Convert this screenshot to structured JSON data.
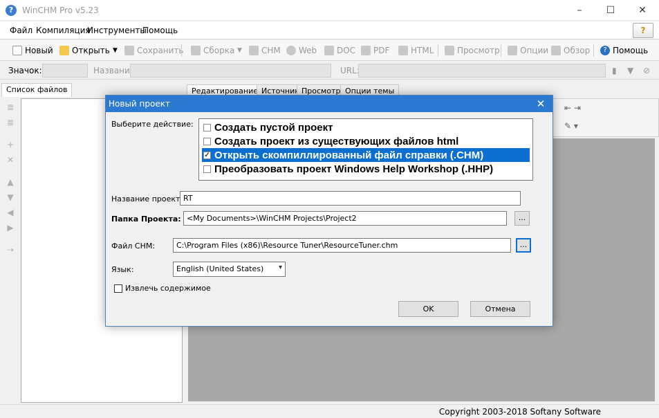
{
  "app": {
    "title": "WinCHM Pro v5.23",
    "icon_glyph": "?",
    "window_controls": {
      "minimize": "–",
      "maximize": "☐",
      "close": "✕"
    }
  },
  "menu": {
    "items": [
      "Файл",
      "Компиляция",
      "Инструменты",
      "Помощь"
    ],
    "help_badge": "?"
  },
  "toolbar": {
    "new": "Новый",
    "open": "Открыть",
    "dropdown_arrow": "▼",
    "save": "Сохранить",
    "build": "Сборка",
    "chm": "CHM",
    "web": "Web",
    "doc": "DOC",
    "pdf": "PDF",
    "html": "HTML",
    "preview": "Просмотр",
    "options": "Опции",
    "browse": "Обзор",
    "help": "Помощь"
  },
  "propbar": {
    "icon_label": "Значок:",
    "name_label": "Название:",
    "url_label": "URL:"
  },
  "left_panel": {
    "tab": "Список файлов",
    "side_icons": [
      "≣",
      "≣",
      "+",
      "✕",
      "▲",
      "▼",
      "◀",
      "▶",
      "⇢"
    ]
  },
  "right_panel": {
    "tabs": [
      "Редактирование",
      "Источник",
      "Просмотр",
      "Опции темы"
    ]
  },
  "status": {
    "copyright": "Copyright 2003-2018 Softany Software"
  },
  "dialog": {
    "title": "Новый проект",
    "close_glyph": "✕",
    "choose_action_label": "Выберите действие:",
    "actions": [
      {
        "label": "Создать пустой проект",
        "checked": false
      },
      {
        "label": "Создать проект из существующих файлов html",
        "checked": false
      },
      {
        "label": "Открыть скомпиллированный файл справки (.CHM)",
        "checked": true
      },
      {
        "label": "Преобразовать проект Windows Help Workshop (.HHP)",
        "checked": false
      }
    ],
    "check_mark": "✓",
    "project_name_label": "Название проекта:",
    "project_name_value": "RT",
    "project_folder_label": "Папка Проекта:",
    "project_folder_value": "<My Documents>\\WinCHM Projects\\Project2",
    "chm_file_label": "Файл CHM:",
    "chm_file_value": "C:\\Program Files (x86)\\Resource Tuner\\ResourceTuner.chm",
    "browse_label": "...",
    "language_label": "Язык:",
    "language_value": "English (United States)",
    "extract_label": "Извлечь содержимое",
    "ok_label": "OK",
    "cancel_label": "Отмена"
  }
}
